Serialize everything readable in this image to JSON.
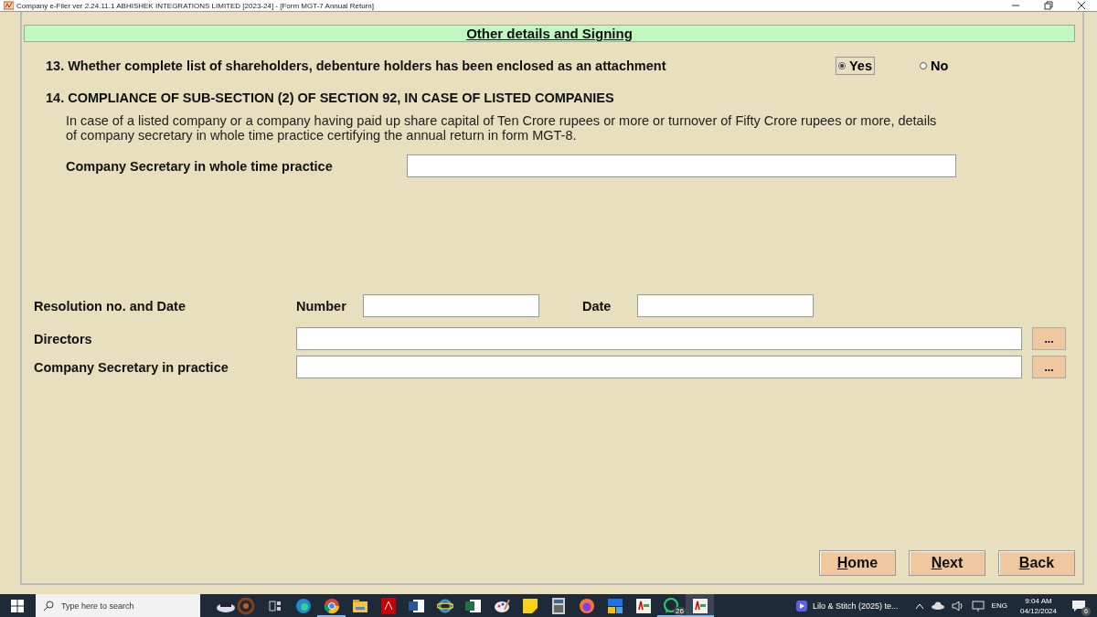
{
  "window": {
    "title": "Company e-Filer ver 2.24.11.1 ABHISHEK INTEGRATIONS LIMITED [2023-24] - [Form MGT-7 Annual Return]"
  },
  "form": {
    "header": "Other details and Signing",
    "q13": {
      "label": "13. Whether complete list of shareholders, debenture holders has been enclosed as an attachment",
      "options": [
        {
          "label": "Yes",
          "selected": true
        },
        {
          "label": "No",
          "selected": false
        }
      ]
    },
    "q14": {
      "heading": "14. COMPLIANCE OF SUB-SECTION (2) OF SECTION 92, IN CASE OF LISTED COMPANIES",
      "text": "In case of a listed company or a company having paid up share capital of Ten Crore rupees or more or turnover of Fifty Crore rupees or more, details of company secretary in whole time practice certifying the annual return in form MGT-8.",
      "field_label": "Company Secretary in whole time practice"
    },
    "resolution": {
      "label": "Resolution no. and Date",
      "number_label": "Number",
      "date_label": "Date"
    },
    "signers": [
      {
        "label": "Directors",
        "button": "..."
      },
      {
        "label": "Company Secretary in practice",
        "button": "..."
      }
    ],
    "nav_buttons": [
      "Home",
      "Next",
      "Back"
    ]
  },
  "taskbar": {
    "search_placeholder": "Type here to search",
    "apps": [
      {
        "kind": "assistant",
        "running": false
      },
      {
        "kind": "taskview",
        "running": false
      },
      {
        "kind": "edge",
        "running": false
      },
      {
        "kind": "chrome",
        "running": true
      },
      {
        "kind": "folder",
        "running": false
      },
      {
        "kind": "pdf",
        "running": false
      },
      {
        "kind": "word",
        "running": false
      },
      {
        "kind": "ie",
        "running": false
      },
      {
        "kind": "excel",
        "running": false
      },
      {
        "kind": "paint",
        "running": false
      },
      {
        "kind": "notes",
        "running": false
      },
      {
        "kind": "calc",
        "running": false
      },
      {
        "kind": "firefox",
        "running": false
      },
      {
        "kind": "tiles",
        "running": false
      },
      {
        "kind": "gst",
        "running": false
      },
      {
        "kind": "chat",
        "running": true,
        "badge": "26"
      },
      {
        "kind": "gst",
        "running": true
      }
    ],
    "media": "Lilo & Stitch (2025) te...",
    "language": "ENG",
    "time": "9:04 AM",
    "date": "04/12/2024",
    "notifications": "6"
  }
}
